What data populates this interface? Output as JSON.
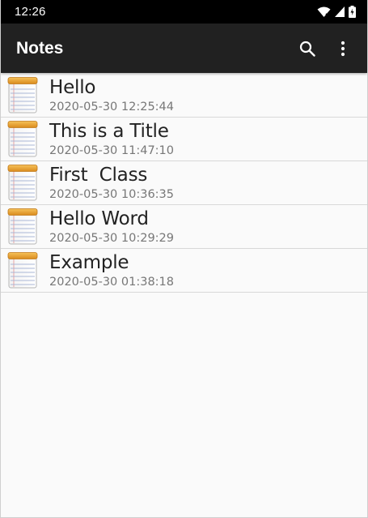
{
  "status_bar": {
    "time": "12:26",
    "icons": [
      "wifi-icon",
      "cell-signal-icon",
      "battery-charging-icon"
    ]
  },
  "toolbar": {
    "title": "Notes",
    "actions": [
      "search-icon",
      "more-vert-icon"
    ],
    "background": "#212121"
  },
  "notes": [
    {
      "title": "Hello",
      "date": "2020-05-30 12:25:44"
    },
    {
      "title": "This is a Title",
      "date": "2020-05-30 11:47:10"
    },
    {
      "title": "First  Class",
      "date": "2020-05-30 10:36:35"
    },
    {
      "title": "Hello Word",
      "date": "2020-05-30 10:29:29"
    },
    {
      "title": "Example",
      "date": "2020-05-30 01:38:18"
    }
  ],
  "colors": {
    "status_bar": "#000000",
    "list_background": "#fafafa",
    "divider": "#d8d8d8",
    "title_text": "#222222",
    "date_text": "#777777",
    "notepad_binding": "#e8a030"
  }
}
